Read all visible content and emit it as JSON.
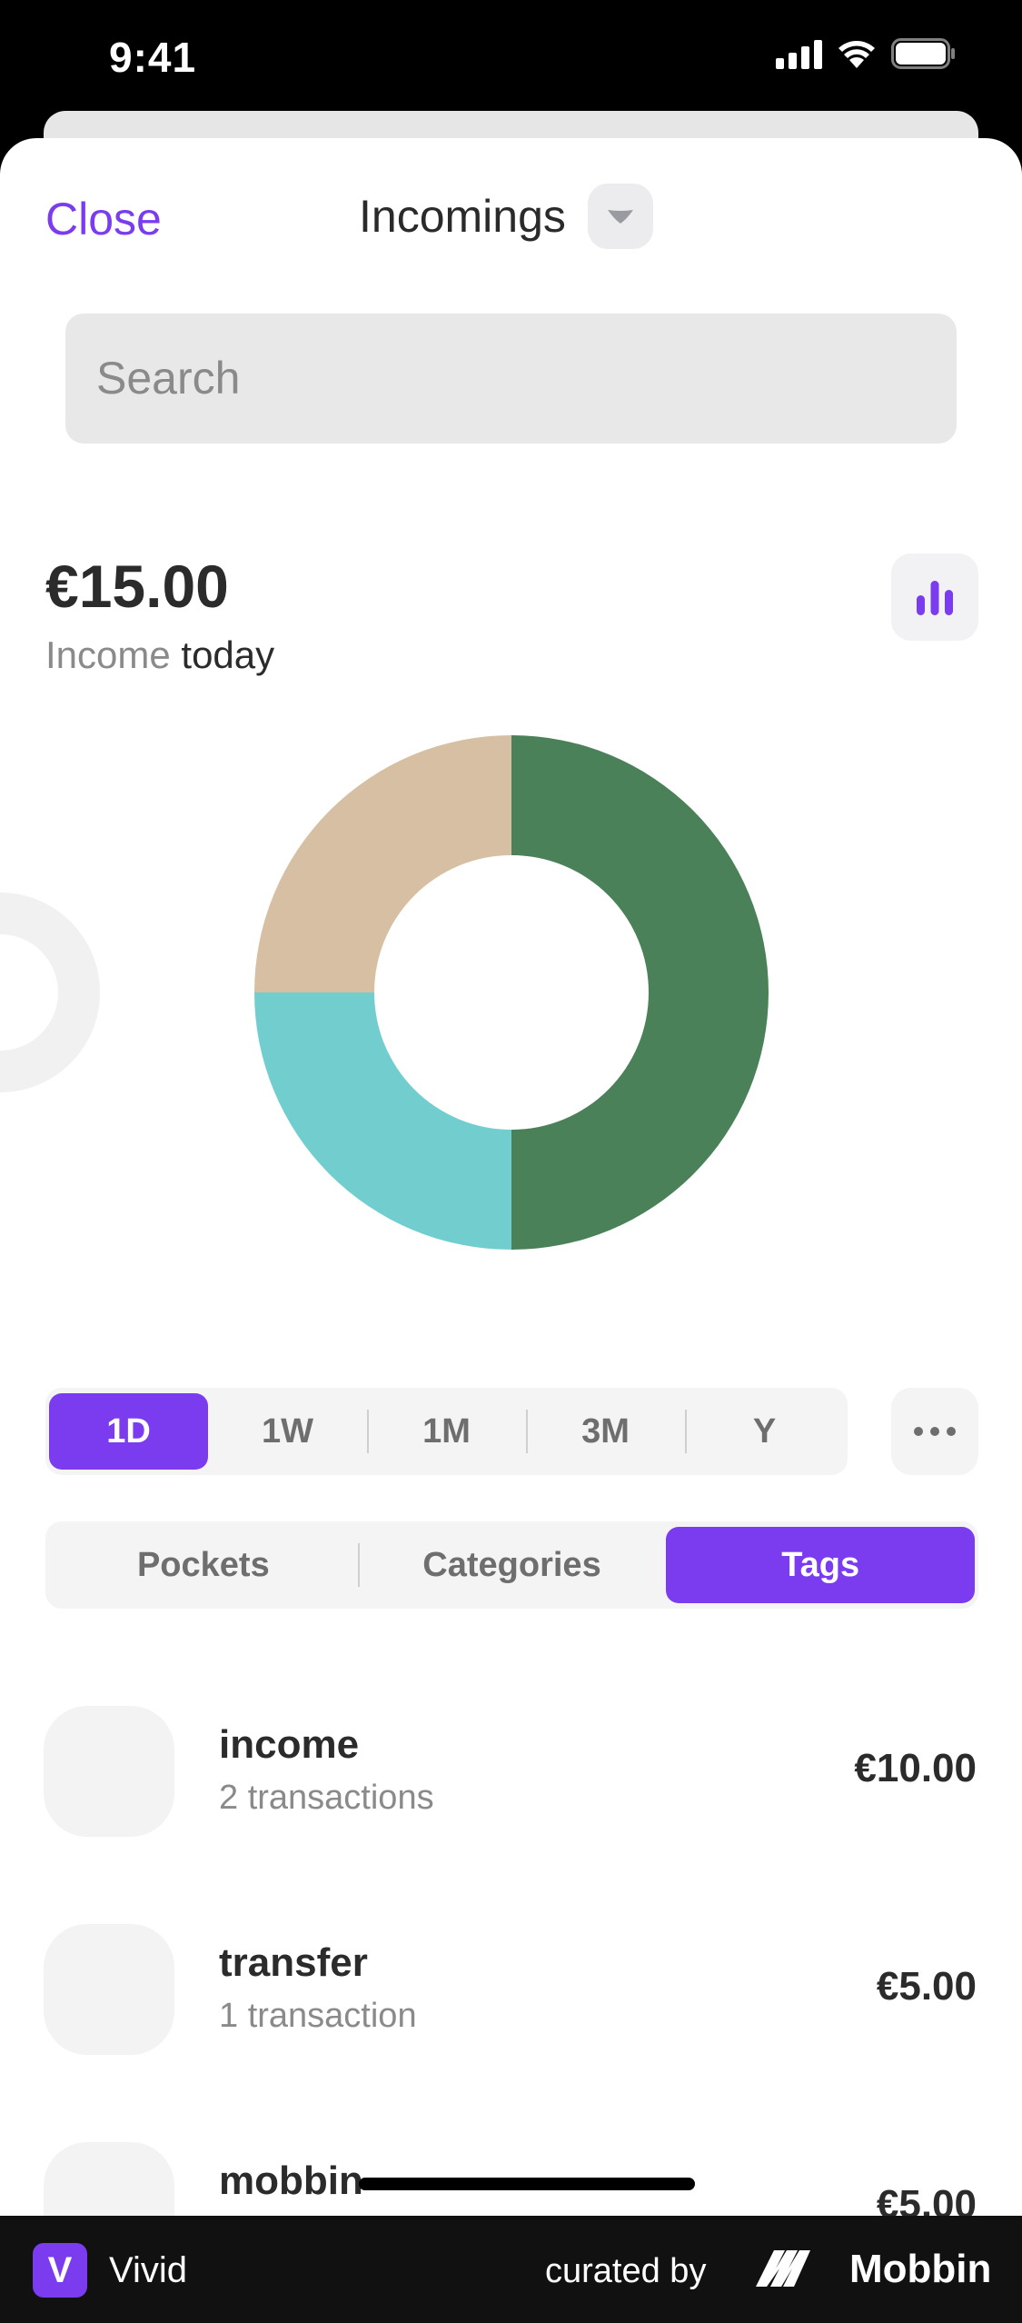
{
  "status_bar": {
    "time": "9:41"
  },
  "header": {
    "close_label": "Close",
    "title": "Incomings"
  },
  "search": {
    "placeholder": "Search"
  },
  "summary": {
    "amount": "€15.00",
    "label_muted": "Income",
    "label_period": "today"
  },
  "chart_data": {
    "type": "pie",
    "hole": true,
    "slices": [
      {
        "value": 50,
        "color": "#4a8159"
      },
      {
        "value": 25,
        "color": "#72cece"
      },
      {
        "value": 25,
        "color": "#d7bfa3"
      }
    ]
  },
  "periods": {
    "items": [
      "1D",
      "1W",
      "1M",
      "3M",
      "Y"
    ],
    "active": "1D"
  },
  "segments": {
    "items": [
      "Pockets",
      "Categories",
      "Tags"
    ],
    "active": "Tags"
  },
  "list": [
    {
      "name": "income",
      "sub": "2 transactions",
      "amount": "€10.00"
    },
    {
      "name": "transfer",
      "sub": "1 transaction",
      "amount": "€5.00"
    },
    {
      "name": "mobbin",
      "sub": "",
      "amount": "€5.00"
    }
  ],
  "footer": {
    "app_initial": "V",
    "app_name": "Vivid",
    "curated_label": "curated by",
    "brand": "Mobbin"
  },
  "colors": {
    "accent": "#7b3cf0"
  },
  "icons": [
    "cellular-signal-icon",
    "wifi-icon",
    "battery-icon",
    "chevron-down-icon",
    "bar-chart-icon",
    "more-icon"
  ]
}
